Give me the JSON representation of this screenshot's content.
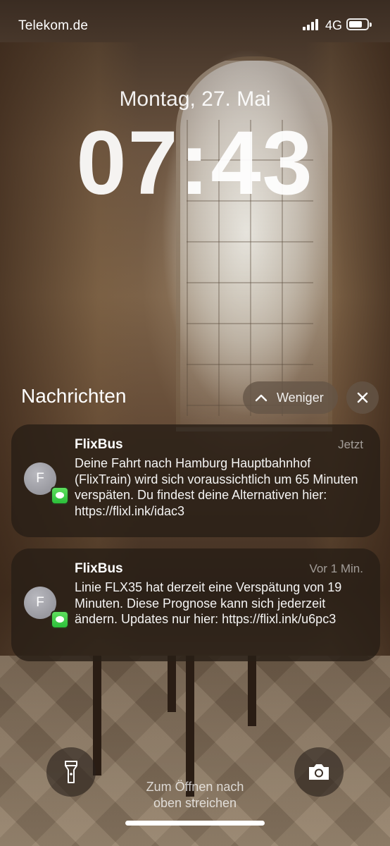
{
  "status_bar": {
    "carrier": "Telekom.de",
    "network": "4G",
    "signal_bars": 4,
    "battery_level": 0.75
  },
  "lock_screen": {
    "date": "Montag, 27. Mai",
    "time": "07:43"
  },
  "notifications_header": {
    "title": "Nachrichten",
    "less_button_label": "Weniger",
    "less_icon": "chevron-up-icon",
    "close_icon": "close-icon"
  },
  "notifications": [
    {
      "sender": "FlixBus",
      "avatar_initial": "F",
      "timestamp": "Jetzt",
      "body": "Deine Fahrt nach Hamburg Hauptbahnhof (FlixTrain)  wird sich voraussichtlich um 65 Minuten verspäten. Du findest deine Alternativen hier: https://flixl.ink/idac3",
      "app_icon": "messages-icon"
    },
    {
      "sender": "FlixBus",
      "avatar_initial": "F",
      "timestamp": "Vor 1 Min.",
      "body": "Linie FLX35 hat derzeit eine Verspätung von 19 Minuten. Diese Prognose kann sich jederzeit ändern. Updates nur hier: https://flixl.ink/u6pc3",
      "app_icon": "messages-icon"
    }
  ],
  "bottom": {
    "flashlight_icon": "flashlight-icon",
    "camera_icon": "camera-icon",
    "unlock_hint": "Zum Öffnen nach\noben streichen"
  },
  "colors": {
    "badge_green": "#34c759",
    "notification_bg": "#28201a"
  }
}
